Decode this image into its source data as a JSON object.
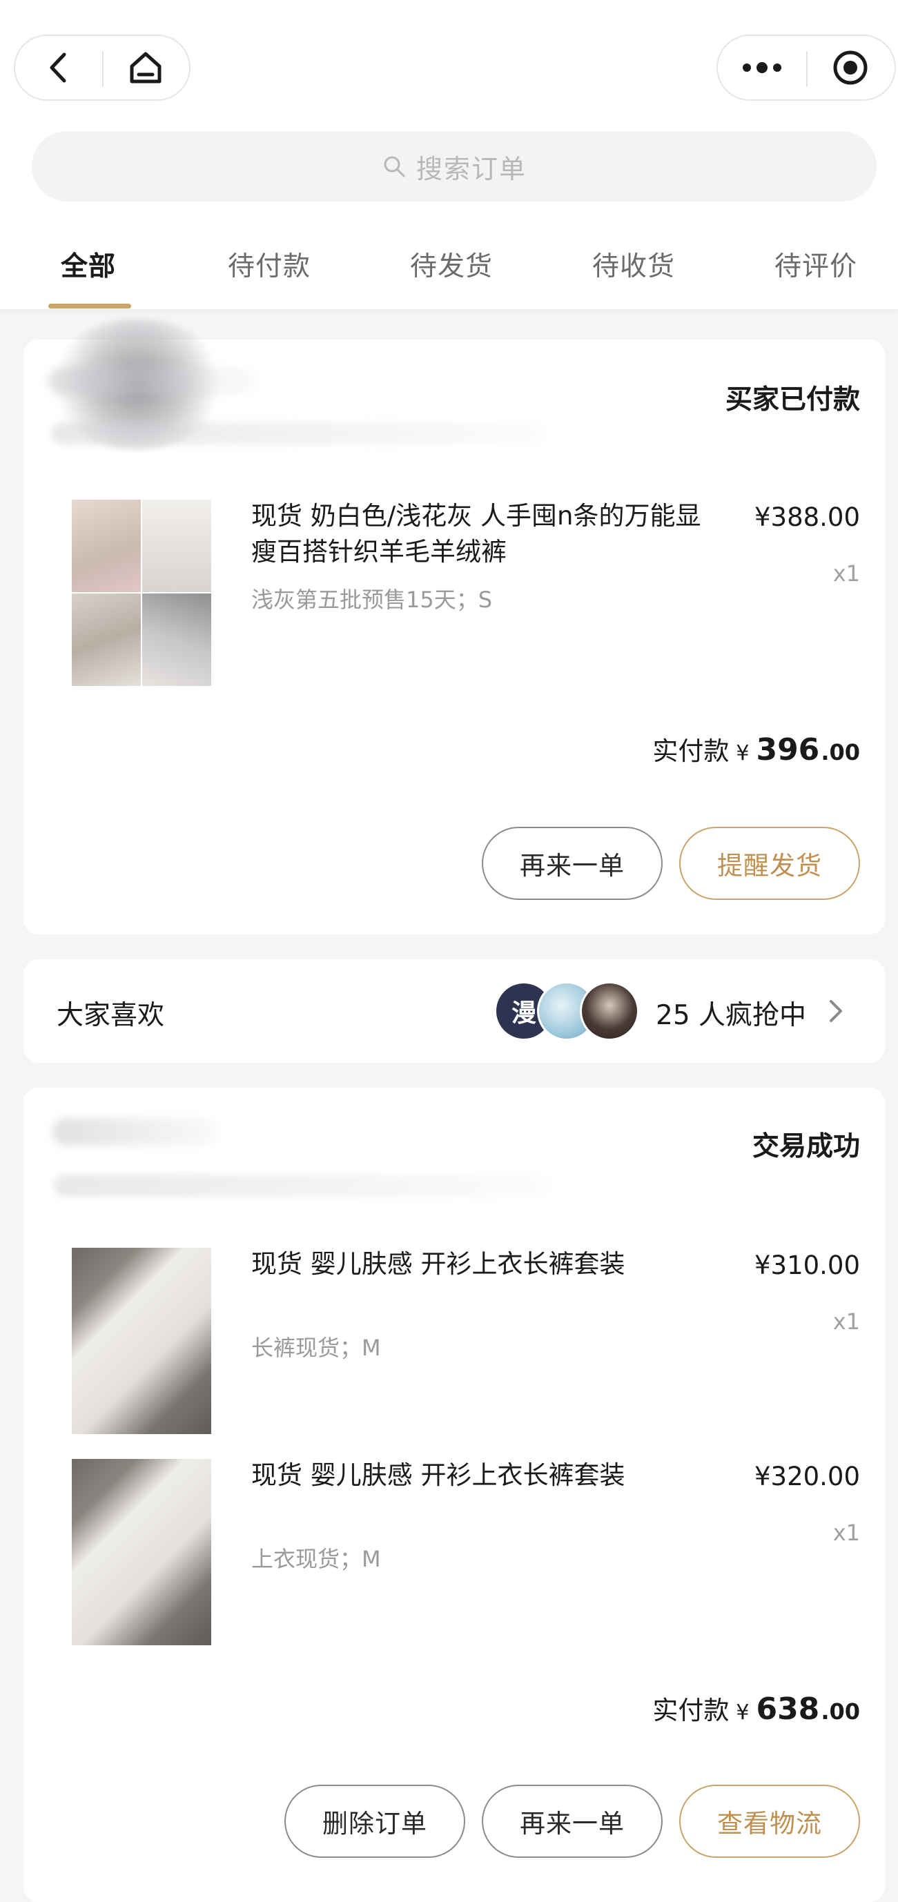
{
  "header": {
    "back_icon": "chevron-left-icon",
    "home_icon": "home-icon",
    "more_icon": "more-dots-icon",
    "close_icon": "target-icon",
    "search_placeholder": "搜索订单"
  },
  "tabs": [
    {
      "label": "全部",
      "active": true
    },
    {
      "label": "待付款",
      "active": false
    },
    {
      "label": "待发货",
      "active": false
    },
    {
      "label": "待收货",
      "active": false
    },
    {
      "label": "待评价",
      "active": false
    }
  ],
  "orders": [
    {
      "status": "买家已付款",
      "items": [
        {
          "title": "现货 奶白色/浅花灰 人手囤n条的万能显瘦百搭针织羊毛羊绒裤",
          "spec": "浅灰第五批预售15天；S",
          "price": "¥388.00",
          "qty": "x1"
        }
      ],
      "paid_label": "实付款",
      "paid_currency": "¥",
      "paid_int": "396",
      "paid_dec": ".00",
      "buttons": [
        "再来一单",
        "提醒发货"
      ]
    },
    {
      "status": "交易成功",
      "items": [
        {
          "title": "现货 婴儿肤感 开衫上衣长裤套装",
          "spec": "长裤现货；M",
          "price": "¥310.00",
          "qty": "x1"
        },
        {
          "title": "现货 婴儿肤感 开衫上衣长裤套装",
          "spec": "上衣现货；M",
          "price": "¥320.00",
          "qty": "x1"
        }
      ],
      "paid_label": "实付款",
      "paid_currency": "¥",
      "paid_int": "638",
      "paid_dec": ".00",
      "buttons": [
        "删除订单",
        "再来一单",
        "查看物流"
      ]
    }
  ],
  "recommend": {
    "title": "大家喜欢",
    "avatar1_text": "漫",
    "count_text": "25 人疯抢中"
  },
  "colors": {
    "accent_gold": "#c9a46b",
    "background": "#f5f5f7"
  }
}
